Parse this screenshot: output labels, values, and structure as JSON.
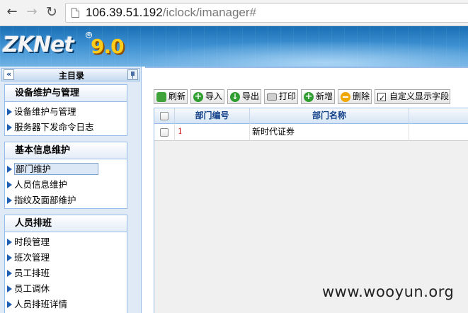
{
  "browser": {
    "url_host": "106.39.51.192",
    "url_path": "/iclock/imanager#"
  },
  "banner": {
    "logo_text": "ZKNet",
    "logo_reg": "®",
    "logo_version": "9.0"
  },
  "sidebar": {
    "title": "主目录",
    "collapse_label": "«",
    "groups": [
      {
        "title": "设备维护与管理",
        "items": [
          "设备维护与管理",
          "服务器下发命令日志"
        ]
      },
      {
        "title": "基本信息维护",
        "items": [
          "部门维护",
          "人员信息维护",
          "指纹及面部维护"
        ],
        "selected": "部门维护"
      },
      {
        "title": "人员排班",
        "items": [
          "时段管理",
          "班次管理",
          "员工排班",
          "员工调休",
          "人员排班详情"
        ]
      }
    ]
  },
  "toolbar": {
    "refresh": "刷新",
    "import": "导入",
    "export": "导出",
    "print": "打印",
    "add": "新增",
    "delete": "删除",
    "custom_fields": "自定义显示字段"
  },
  "grid": {
    "columns": [
      "部门编号",
      "部门名称"
    ],
    "rows": [
      {
        "code": "1",
        "name": "新时代证券"
      }
    ]
  },
  "watermark": "www.wooyun.org"
}
